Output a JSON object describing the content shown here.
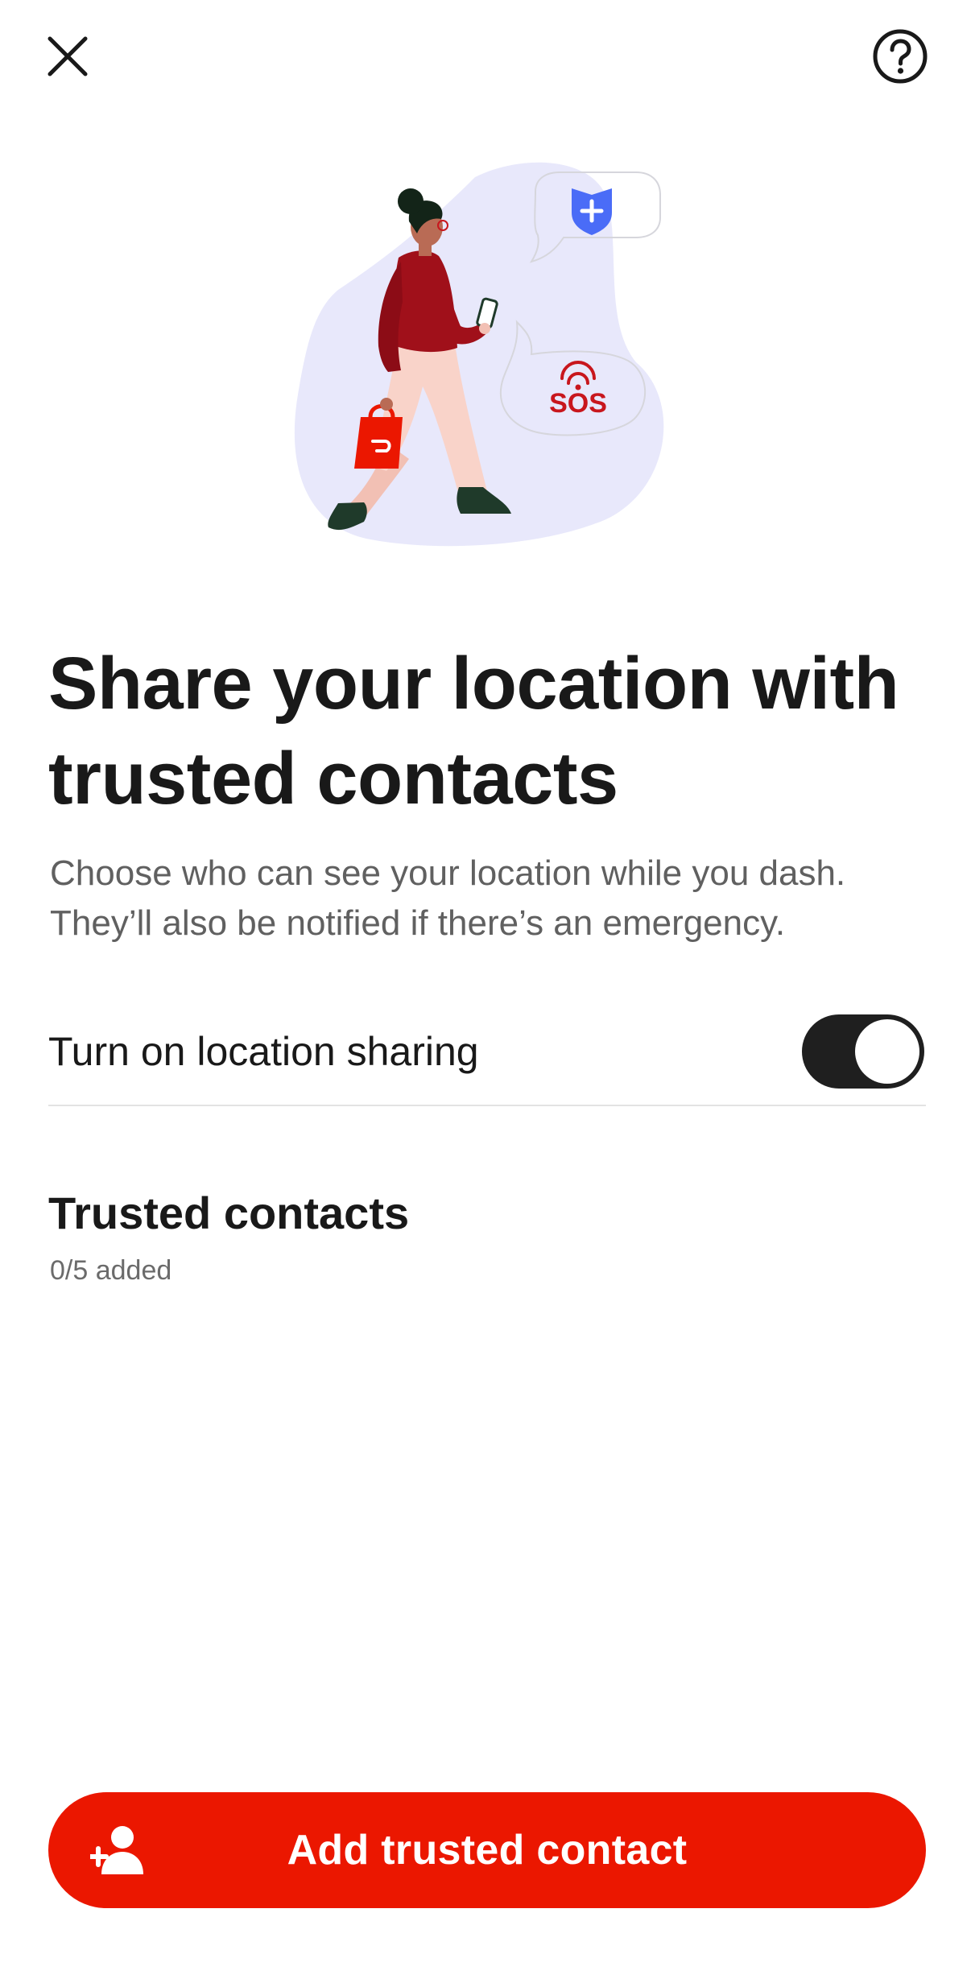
{
  "header": {
    "close_icon": "close-icon",
    "help_icon": "help-circle-icon"
  },
  "hero": {
    "illustration": "woman-walking-with-phone-and-bag",
    "sos_label": "SOS",
    "colors": {
      "blob": "#e8e8fb",
      "shield": "#4a6cf7",
      "sweater": "#a0101a",
      "pants": "#f9d3c9",
      "bag": "#eb1700",
      "shoes": "#1f3a2a"
    }
  },
  "title": "Share your location with trusted contacts",
  "subtitle": "Choose who can see your location while you dash. They’ll also be notified if there’s an emergency.",
  "location_sharing": {
    "label": "Turn on location sharing",
    "enabled": true
  },
  "trusted_contacts": {
    "title": "Trusted contacts",
    "count_text": "0/5 added"
  },
  "primary_button": {
    "label": "Add trusted contact",
    "icon": "add-person-icon",
    "color": "#eb1700"
  }
}
